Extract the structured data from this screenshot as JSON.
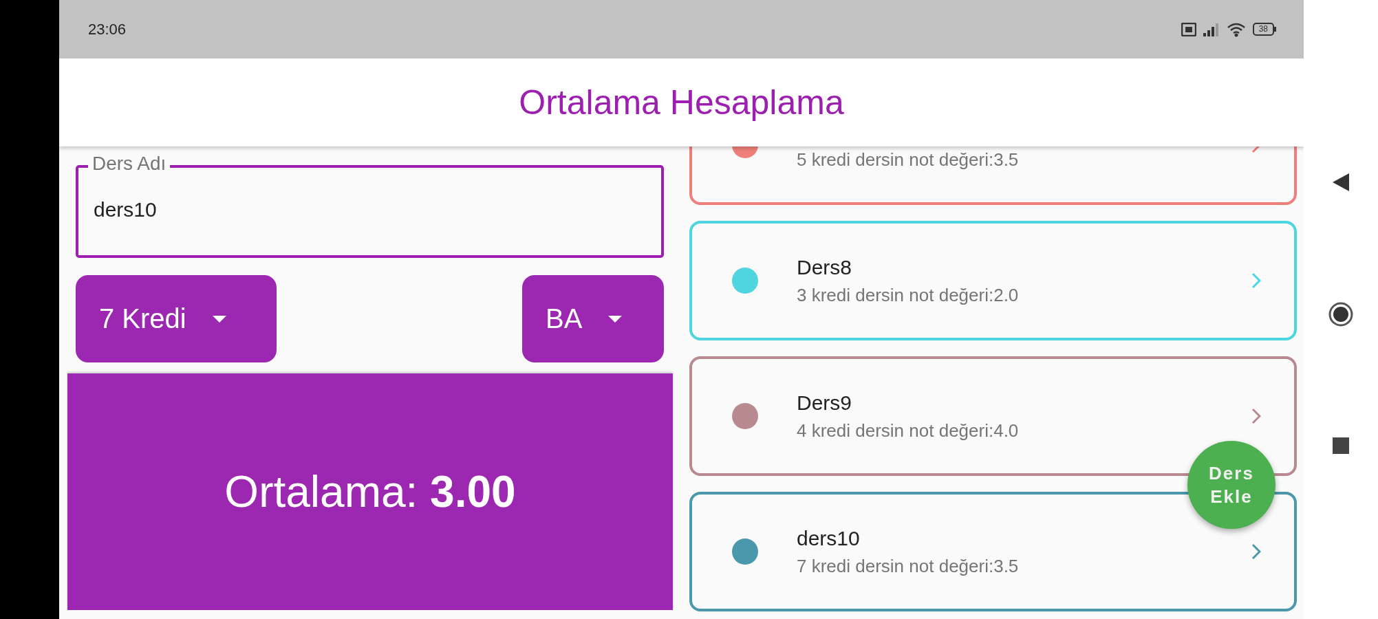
{
  "status_bar": {
    "time": "23:06",
    "battery": "38"
  },
  "app_bar": {
    "title": "Ortalama Hesaplama"
  },
  "form": {
    "name_field": {
      "label": "Ders Adı",
      "value": "ders10"
    },
    "dropdowns": [
      {
        "value": "7 Kredi"
      },
      {
        "value": "BA"
      }
    ]
  },
  "average": {
    "text": "Ortalama: **3.00**"
  },
  "courses": [
    {
      "subtitle": "5 kredi dersin not değeri:3.5",
      "color": "#ef7f7a"
    },
    {
      "title": "Ders8",
      "subtitle": "3 kredi dersin not değeri:2.0",
      "color": "#4fd5df"
    },
    {
      "title": "Ders9",
      "subtitle": "4 kredi dersin not değeri:4.0",
      "color": "#b98990"
    },
    {
      "title": "ders10",
      "subtitle": "7 kredi dersin not değeri:3.5",
      "color": "#4b97ab"
    }
  ],
  "fab": {
    "label": "Ders Ekle"
  }
}
